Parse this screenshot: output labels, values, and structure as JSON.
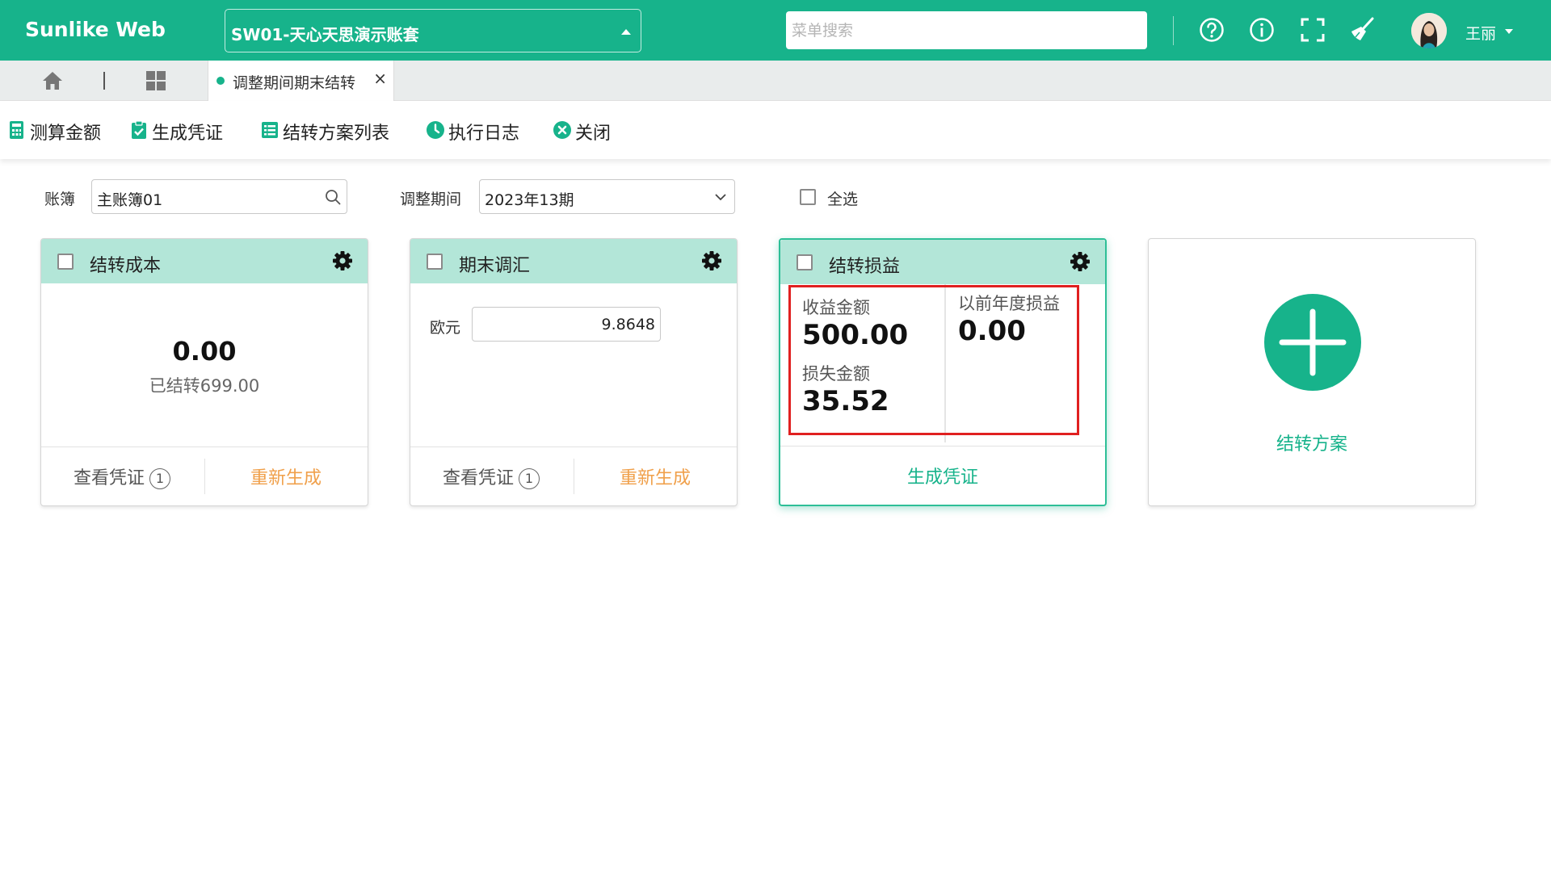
{
  "app": {
    "brand": "Sunlike Web",
    "account_set": "SW01-天心天思演示账套",
    "menu_search_placeholder": "菜单搜索",
    "user_name": "王丽"
  },
  "icons": {
    "help": "help-icon",
    "info": "info-icon",
    "fullscreen": "fullscreen-icon",
    "clean": "broom-icon",
    "home": "home-icon",
    "apps": "apps-grid-icon"
  },
  "colors": {
    "brand": "#17b38b",
    "card_header": "#b3e6d8",
    "regenerate": "#f0a04b",
    "highlight_border": "#e02020"
  },
  "tabs": [
    {
      "label": "调整期间期末结转",
      "active": true
    }
  ],
  "toolbar": {
    "calc": "测算金额",
    "generate": "生成凭证",
    "scheme_list": "结转方案列表",
    "log": "执行日志",
    "close": "关闭"
  },
  "filters": {
    "ledger_label": "账簿",
    "ledger_value": "主账簿01",
    "period_label": "调整期间",
    "period_value": "2023年13期",
    "select_all_label": "全选"
  },
  "cards": {
    "cost": {
      "title": "结转成本",
      "amount": "0.00",
      "transferred": "已结转699.00",
      "view_voucher": "查看凭证",
      "voucher_count": "1",
      "regenerate": "重新生成"
    },
    "exchange": {
      "title": "期末调汇",
      "currency_label": "欧元",
      "rate": "9.8648",
      "view_voucher": "查看凭证",
      "voucher_count": "1",
      "regenerate": "重新生成"
    },
    "profit_loss": {
      "title": "结转损益",
      "income_label": "收益金额",
      "income_value": "500.00",
      "prior_year_label": "以前年度损益",
      "prior_year_value": "0.00",
      "loss_label": "损失金额",
      "loss_value": "35.52",
      "generate_voucher": "生成凭证"
    },
    "add_scheme": {
      "label": "结转方案"
    }
  }
}
